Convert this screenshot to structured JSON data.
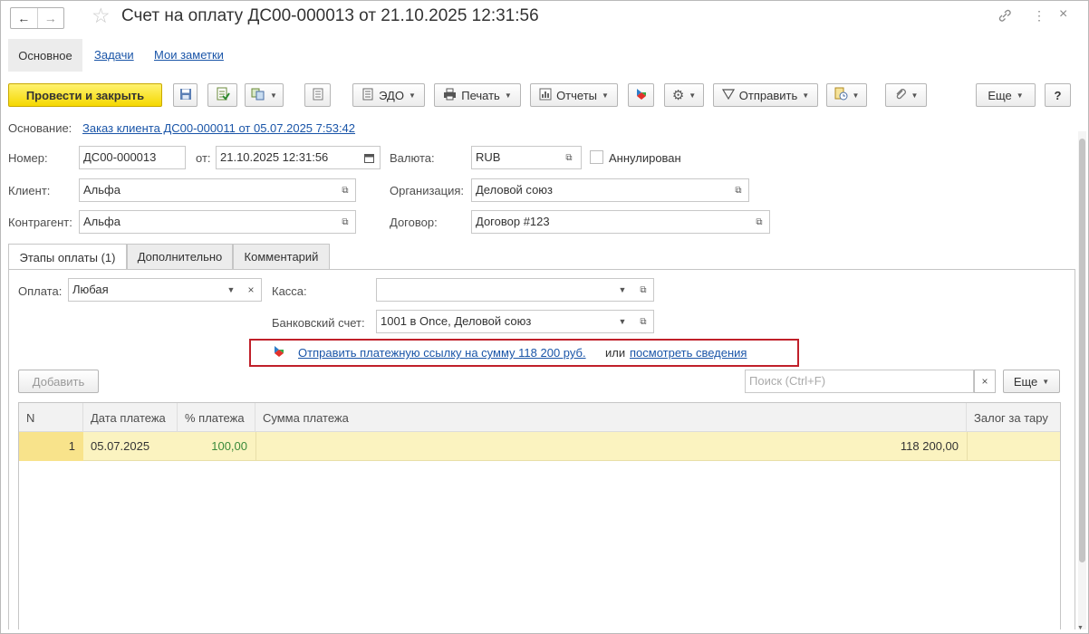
{
  "window": {
    "title": "Счет на оплату ДС00-000013 от 21.10.2025 12:31:56",
    "back_icon": "←",
    "forward_icon": "→",
    "star_icon": "☆",
    "link_icon": "🔗",
    "more_icon": "⋮",
    "close_icon": "×"
  },
  "nav_tabs": [
    "Основное",
    "Задачи",
    "Мои заметки"
  ],
  "toolbar": {
    "post_close": "Провести и закрыть",
    "edo": "ЭДО",
    "print": "Печать",
    "reports": "Отчеты",
    "send": "Отправить",
    "more": "Еще",
    "help": "?"
  },
  "basis": {
    "label": "Основание:",
    "link": "Заказ клиента ДС00-000011 от 05.07.2025 7:53:42"
  },
  "fields": {
    "number_label": "Номер:",
    "number": "ДС00-000013",
    "from_label": "от:",
    "date": "21.10.2025 12:31:56",
    "currency_label": "Валюта:",
    "currency": "RUB",
    "cancelled_label": "Аннулирован",
    "client_label": "Клиент:",
    "client": "Альфа",
    "org_label": "Организация:",
    "org": "Деловой союз",
    "counterparty_label": "Контрагент:",
    "counterparty": "Альфа",
    "contract_label": "Договор:",
    "contract": "Договор #123"
  },
  "tabs": [
    "Этапы оплаты (1)",
    "Дополнительно",
    "Комментарий"
  ],
  "payment": {
    "payment_label": "Оплата:",
    "payment_value": "Любая",
    "cash_label": "Касса:",
    "cash_value": "",
    "bank_label": "Банковский счет:",
    "bank_value": "1001 в Once, Деловой союз",
    "send_link": "Отправить платежную ссылку на сумму 118 200 руб.",
    "or": "или",
    "view_link": "посмотреть сведения"
  },
  "table_toolbar": {
    "add": "Добавить",
    "search_placeholder": "Поиск (Ctrl+F)",
    "more": "Еще"
  },
  "table": {
    "columns": [
      "N",
      "Дата платежа",
      "% платежа",
      "Сумма платежа",
      "Залог за тару"
    ],
    "rows": [
      {
        "n": "1",
        "date": "05.07.2025",
        "percent": "100,00",
        "amount": "118 200,00",
        "deposit": ""
      }
    ]
  },
  "colors": {
    "accent_yellow": "#f5d800",
    "link_blue": "#1a55a8",
    "highlight_red": "#c0202a",
    "row_selected": "#fbf3c0",
    "percent_green": "#3b8a3b"
  }
}
